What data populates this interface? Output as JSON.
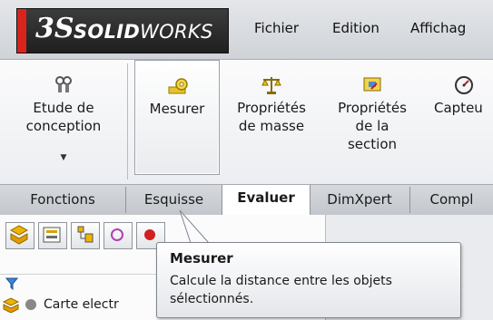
{
  "app": {
    "logo_mark": "3S",
    "logo_text_bold": "SOLID",
    "logo_text_italic": "WORKS",
    "brand_color": "#d8241d"
  },
  "menubar": {
    "items": [
      "Fichier",
      "Edition",
      "Affichag"
    ]
  },
  "ribbon": {
    "tools": [
      {
        "label": "Etude de conception",
        "icon": "design-study-icon"
      },
      {
        "label": "Mesurer",
        "icon": "measure-icon",
        "active": true
      },
      {
        "label": "Propriétés de masse",
        "icon": "mass-properties-icon"
      },
      {
        "label": "Propriétés de la section",
        "icon": "section-properties-icon"
      },
      {
        "label": "Capteu",
        "icon": "sensor-icon"
      }
    ]
  },
  "tabs": [
    "Fonctions",
    "Esquisse",
    "Evaluer",
    "DimXpert",
    "Compl"
  ],
  "active_tab": "Evaluer",
  "tree": {
    "first_item": "Carte electr"
  },
  "tooltip": {
    "title": "Mesurer",
    "description": "Calcule la distance entre les objets sélectionnés."
  }
}
